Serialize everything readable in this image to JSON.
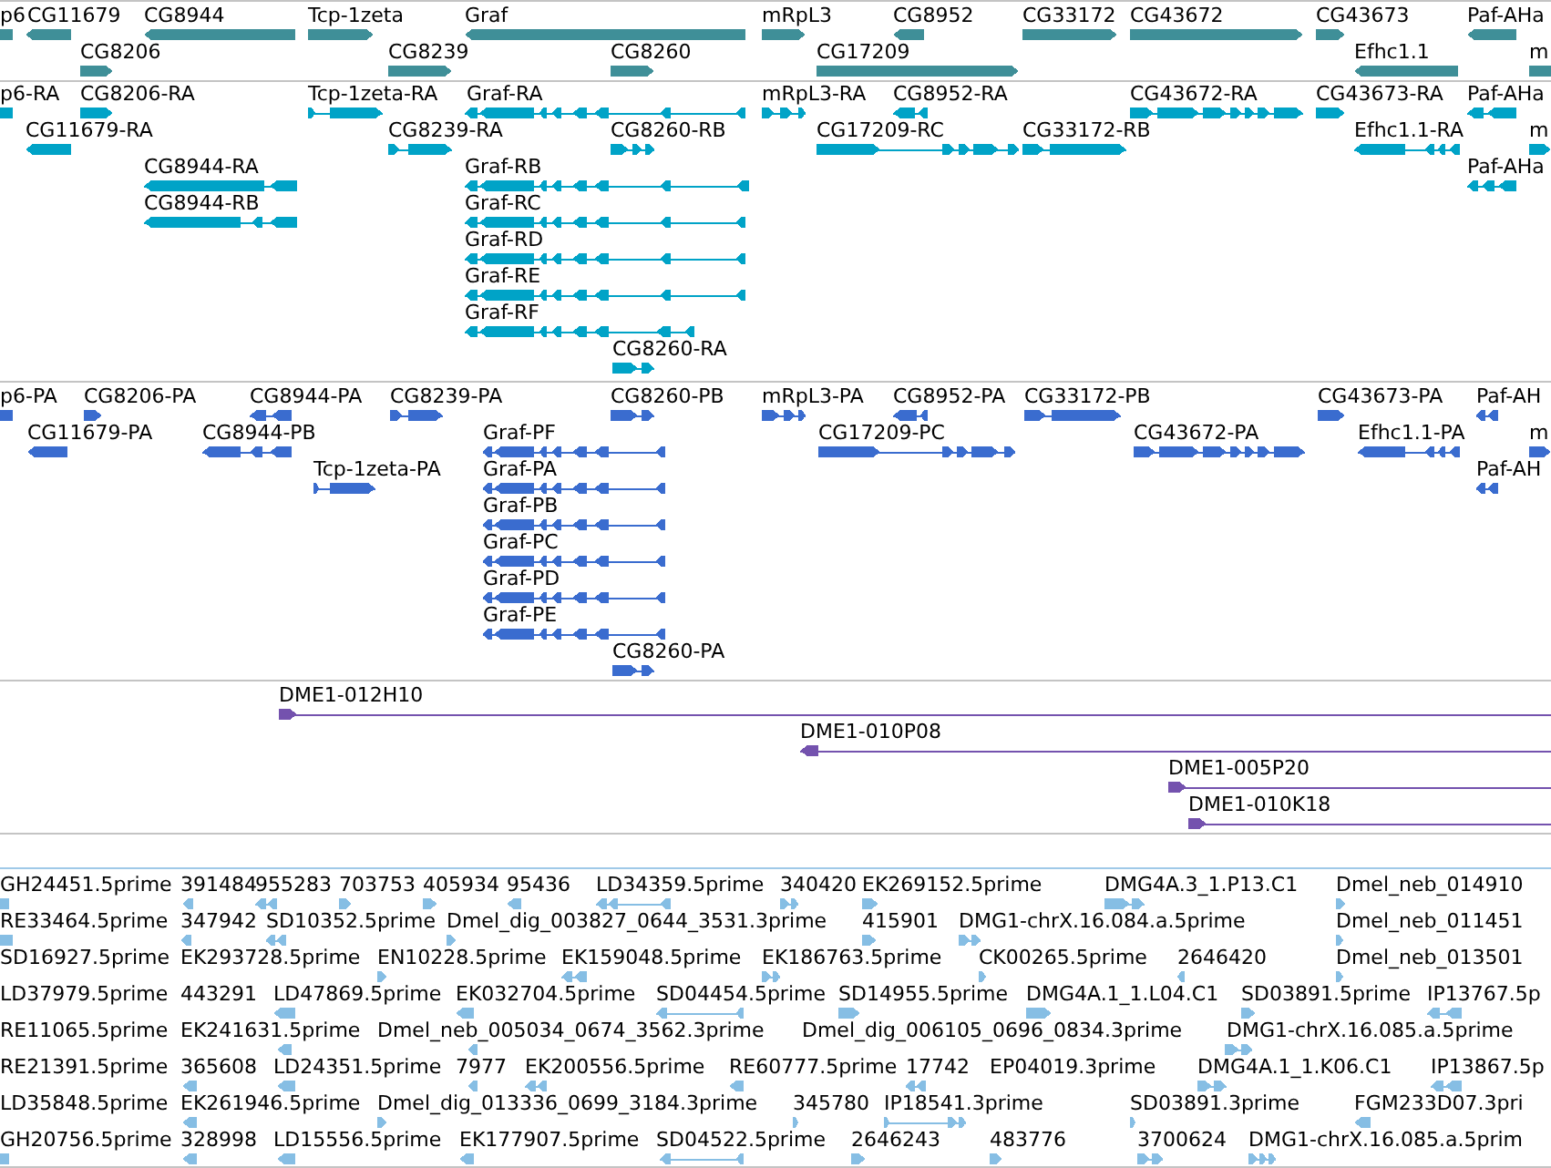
{
  "tracks": [
    {
      "kind": "gene",
      "rows": [
        {
          "features": [
            {
              "label": "p6"
            },
            {
              "label": "CG11679",
              "reverse": true
            },
            {
              "label": "CG8944",
              "reverse": true
            },
            {
              "label": "Tcp-1zeta",
              "reverse": false
            },
            {
              "label": "Graf",
              "reverse": true
            },
            {
              "label": "mRpL3",
              "reverse": false
            },
            {
              "label": "CG8952",
              "reverse": true
            },
            {
              "label": "CG33172",
              "reverse": false
            },
            {
              "label": "CG43672",
              "reverse": false
            },
            {
              "label": "CG43673",
              "reverse": false
            },
            {
              "label": "Paf-AHa",
              "reverse": true
            }
          ]
        },
        {
          "features": [
            {
              "label": "CG8206",
              "reverse": false
            },
            {
              "label": "CG8239",
              "reverse": false
            },
            {
              "label": "CG8260",
              "reverse": false
            },
            {
              "label": "CG17209",
              "reverse": false
            },
            {
              "label": "Efhc1.1",
              "reverse": true
            },
            {
              "label": "m"
            }
          ]
        }
      ]
    },
    {
      "kind": "transcript",
      "rows": [
        {
          "features": [
            {
              "label": "p6-RA"
            },
            {
              "label": "CG8206-RA",
              "reverse": false
            },
            {
              "label": "Tcp-1zeta-RA",
              "reverse": false
            },
            {
              "label": "Graf-RA",
              "reverse": true
            },
            {
              "label": "mRpL3-RA",
              "reverse": false
            },
            {
              "label": "CG8952-RA",
              "reverse": true
            },
            {
              "label": "CG43672-RA",
              "reverse": false
            },
            {
              "label": "CG43673-RA",
              "reverse": false
            },
            {
              "label": "Paf-AHa",
              "reverse": true
            }
          ]
        },
        {
          "features": [
            {
              "label": "CG11679-RA",
              "reverse": true
            },
            {
              "label": "CG8239-RA",
              "reverse": false
            },
            {
              "label": "CG8260-RB",
              "reverse": false
            },
            {
              "label": "CG17209-RC",
              "reverse": false
            },
            {
              "label": "CG33172-RB",
              "reverse": false
            },
            {
              "label": "Efhc1.1-RA",
              "reverse": true
            },
            {
              "label": "m",
              "reverse": false
            }
          ]
        },
        {
          "features": [
            {
              "label": "CG8944-RA",
              "reverse": true
            },
            {
              "label": "Graf-RB",
              "reverse": true
            },
            {
              "label": "Paf-AHa",
              "reverse": true
            }
          ]
        },
        {
          "features": [
            {
              "label": "CG8944-RB",
              "reverse": true
            },
            {
              "label": "Graf-RC",
              "reverse": true
            }
          ]
        },
        {
          "features": [
            {
              "label": "Graf-RD",
              "reverse": true
            }
          ]
        },
        {
          "features": [
            {
              "label": "Graf-RE",
              "reverse": true
            }
          ]
        },
        {
          "features": [
            {
              "label": "Graf-RF",
              "reverse": true
            }
          ]
        },
        {
          "features": [
            {
              "label": "CG8260-RA",
              "reverse": false
            }
          ]
        }
      ]
    },
    {
      "kind": "protein",
      "rows": [
        {
          "features": [
            {
              "label": "p6-PA"
            },
            {
              "label": "CG8206-PA",
              "reverse": false
            },
            {
              "label": "CG8944-PA",
              "reverse": true
            },
            {
              "label": "CG8239-PA",
              "reverse": false
            },
            {
              "label": "CG8260-PB",
              "reverse": false
            },
            {
              "label": "mRpL3-PA",
              "reverse": false
            },
            {
              "label": "CG8952-PA",
              "reverse": true
            },
            {
              "label": "CG33172-PB",
              "reverse": false
            },
            {
              "label": "CG43673-PA",
              "reverse": false
            },
            {
              "label": "Paf-AH",
              "reverse": true
            }
          ]
        },
        {
          "features": [
            {
              "label": "CG11679-PA",
              "reverse": true
            },
            {
              "label": "CG8944-PB",
              "reverse": true
            },
            {
              "label": "Graf-PF",
              "reverse": true
            },
            {
              "label": "CG17209-PC",
              "reverse": false
            },
            {
              "label": "CG43672-PA",
              "reverse": false
            },
            {
              "label": "Efhc1.1-PA",
              "reverse": true
            },
            {
              "label": "m",
              "reverse": false
            }
          ]
        },
        {
          "features": [
            {
              "label": "Tcp-1zeta-PA",
              "reverse": false
            },
            {
              "label": "Graf-PA",
              "reverse": true
            },
            {
              "label": "Paf-AH",
              "reverse": true
            }
          ]
        },
        {
          "features": [
            {
              "label": "Graf-PB",
              "reverse": true
            }
          ]
        },
        {
          "features": [
            {
              "label": "Graf-PC",
              "reverse": true
            }
          ]
        },
        {
          "features": [
            {
              "label": "Graf-PD",
              "reverse": true
            }
          ]
        },
        {
          "features": [
            {
              "label": "Graf-PE",
              "reverse": true
            }
          ]
        },
        {
          "features": [
            {
              "label": "CG8260-PA",
              "reverse": false
            }
          ]
        }
      ]
    },
    {
      "kind": "clone",
      "rows": [
        {
          "features": [
            {
              "label": "DME1-012H10",
              "reverse": false
            }
          ]
        },
        {
          "features": [
            {
              "label": "DME1-010P08",
              "reverse": true
            }
          ]
        },
        {
          "features": [
            {
              "label": "DME1-005P20",
              "reverse": false
            }
          ]
        },
        {
          "features": [
            {
              "label": "DME1-010K18",
              "reverse": false
            }
          ]
        }
      ]
    },
    {
      "kind": "est",
      "rows": [
        {
          "features": [
            {
              "label": "GH24451.5prime"
            },
            {
              "label": "391484",
              "reverse": true
            },
            {
              "label": "955283",
              "reverse": true
            },
            {
              "label": "703753",
              "reverse": false
            },
            {
              "label": "405934",
              "reverse": false
            },
            {
              "label": "95436",
              "reverse": true
            },
            {
              "label": "LD34359.5prime",
              "reverse": true
            },
            {
              "label": "340420",
              "reverse": false
            },
            {
              "label": "EK269152.5prime",
              "reverse": false
            },
            {
              "label": "DMG4A.3_1.P13.C1",
              "reverse": false
            },
            {
              "label": "Dmel_neb_014910",
              "reverse": false
            }
          ]
        },
        {
          "features": [
            {
              "label": "RE33464.5prime"
            },
            {
              "label": "347942",
              "reverse": true
            },
            {
              "label": "SD10352.5prime",
              "reverse": true
            },
            {
              "label": "Dmel_dig_003827_0644_3531.3prime",
              "reverse": false
            },
            {
              "label": "415901",
              "reverse": false
            },
            {
              "label": "DMG1-chrX.16.084.a.5prime",
              "reverse": false
            },
            {
              "label": "Dmel_neb_011451",
              "reverse": false
            }
          ]
        },
        {
          "features": [
            {
              "label": "SD16927.5prime"
            },
            {
              "label": "EK293728.5prime"
            },
            {
              "label": "EN10228.5prime",
              "reverse": false
            },
            {
              "label": "EK159048.5prime",
              "reverse": true
            },
            {
              "label": "EK186763.5prime",
              "reverse": false
            },
            {
              "label": "CK00265.5prime",
              "reverse": false
            },
            {
              "label": "2646420",
              "reverse": true
            },
            {
              "label": "Dmel_neb_013501",
              "reverse": false
            }
          ]
        },
        {
          "features": [
            {
              "label": "LD37979.5prime"
            },
            {
              "label": "443291"
            },
            {
              "label": "LD47869.5prime",
              "reverse": true
            },
            {
              "label": "EK032704.5prime",
              "reverse": true
            },
            {
              "label": "SD04454.5prime",
              "reverse": true
            },
            {
              "label": "SD14955.5prime",
              "reverse": false
            },
            {
              "label": "DMG4A.1_1.L04.C1",
              "reverse": false
            },
            {
              "label": "SD03891.5prime",
              "reverse": false
            },
            {
              "label": "IP13767.5p",
              "reverse": true
            }
          ]
        },
        {
          "features": [
            {
              "label": "RE11065.5prime"
            },
            {
              "label": "EK241631.5prime",
              "reverse": true
            },
            {
              "label": "Dmel_neb_005034_0674_3562.3prime",
              "reverse": true
            },
            {
              "label": "Dmel_dig_006105_0696_0834.3prime"
            },
            {
              "label": "DMG1-chrX.16.085.a.5prime",
              "reverse": false
            }
          ]
        },
        {
          "features": [
            {
              "label": "RE21391.5prime"
            },
            {
              "label": "365608",
              "reverse": true
            },
            {
              "label": "LD24351.5prime",
              "reverse": true
            },
            {
              "label": "7977",
              "reverse": true
            },
            {
              "label": "EK200556.5prime",
              "reverse": true
            },
            {
              "label": "RE60777.5prime",
              "reverse": true
            },
            {
              "label": "17742",
              "reverse": true
            },
            {
              "label": "EP04019.3prime"
            },
            {
              "label": "DMG4A.1_1.K06.C1",
              "reverse": false
            },
            {
              "label": "IP13867.5p",
              "reverse": true
            }
          ]
        },
        {
          "features": [
            {
              "label": "LD35848.5prime"
            },
            {
              "label": "EK261946.5prime",
              "reverse": true
            },
            {
              "label": "Dmel_dig_013336_0699_3184.3prime",
              "reverse": false
            },
            {
              "label": "345780",
              "reverse": false
            },
            {
              "label": "IP18541.3prime",
              "reverse": false
            },
            {
              "label": "SD03891.3prime",
              "reverse": false
            },
            {
              "label": "FGM233D07.3pri",
              "reverse": true
            }
          ]
        },
        {
          "features": [
            {
              "label": "GH20756.5prime"
            },
            {
              "label": "328998",
              "reverse": true
            },
            {
              "label": "LD15556.5prime",
              "reverse": true
            },
            {
              "label": "EK177907.5prime",
              "reverse": true
            },
            {
              "label": "SD04522.5prime",
              "reverse": true
            },
            {
              "label": "2646243",
              "reverse": false
            },
            {
              "label": "483776",
              "reverse": false
            },
            {
              "label": "3700624",
              "reverse": false
            },
            {
              "label": "DMG1-chrX.16.085.a.5prim",
              "reverse": false
            }
          ]
        }
      ]
    }
  ]
}
